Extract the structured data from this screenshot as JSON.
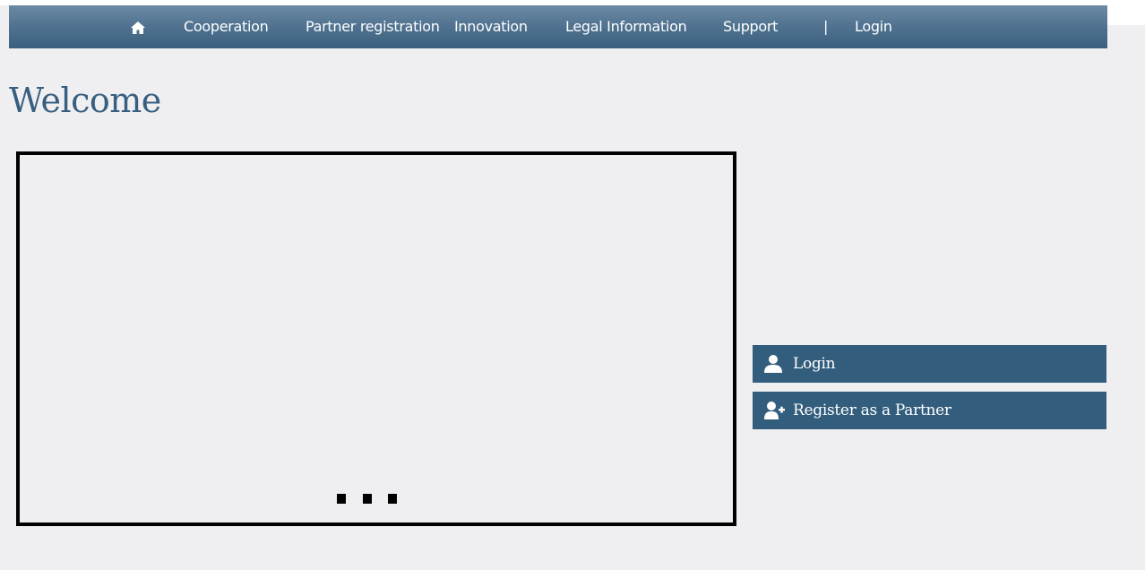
{
  "nav": {
    "home_icon": "home-icon",
    "items": [
      {
        "label": "Cooperation"
      },
      {
        "label": "Partner registration"
      },
      {
        "label": "Innovation"
      },
      {
        "label": "Legal Information"
      },
      {
        "label": "Support"
      }
    ],
    "separator": "|",
    "login_label": "Login"
  },
  "main": {
    "title": "Welcome"
  },
  "slider": {
    "dot_count": 3,
    "state": "loading"
  },
  "actions": {
    "login": {
      "label": "Login",
      "icon": "user-icon"
    },
    "register": {
      "label": "Register as a Partner",
      "icon": "user-add-icon"
    }
  },
  "colors": {
    "nav_gradient_top": "#6c8aa3",
    "nav_gradient_bottom": "#3b5f7e",
    "accent": "#335d7d",
    "title": "#385f80",
    "background": "#efeff1"
  }
}
